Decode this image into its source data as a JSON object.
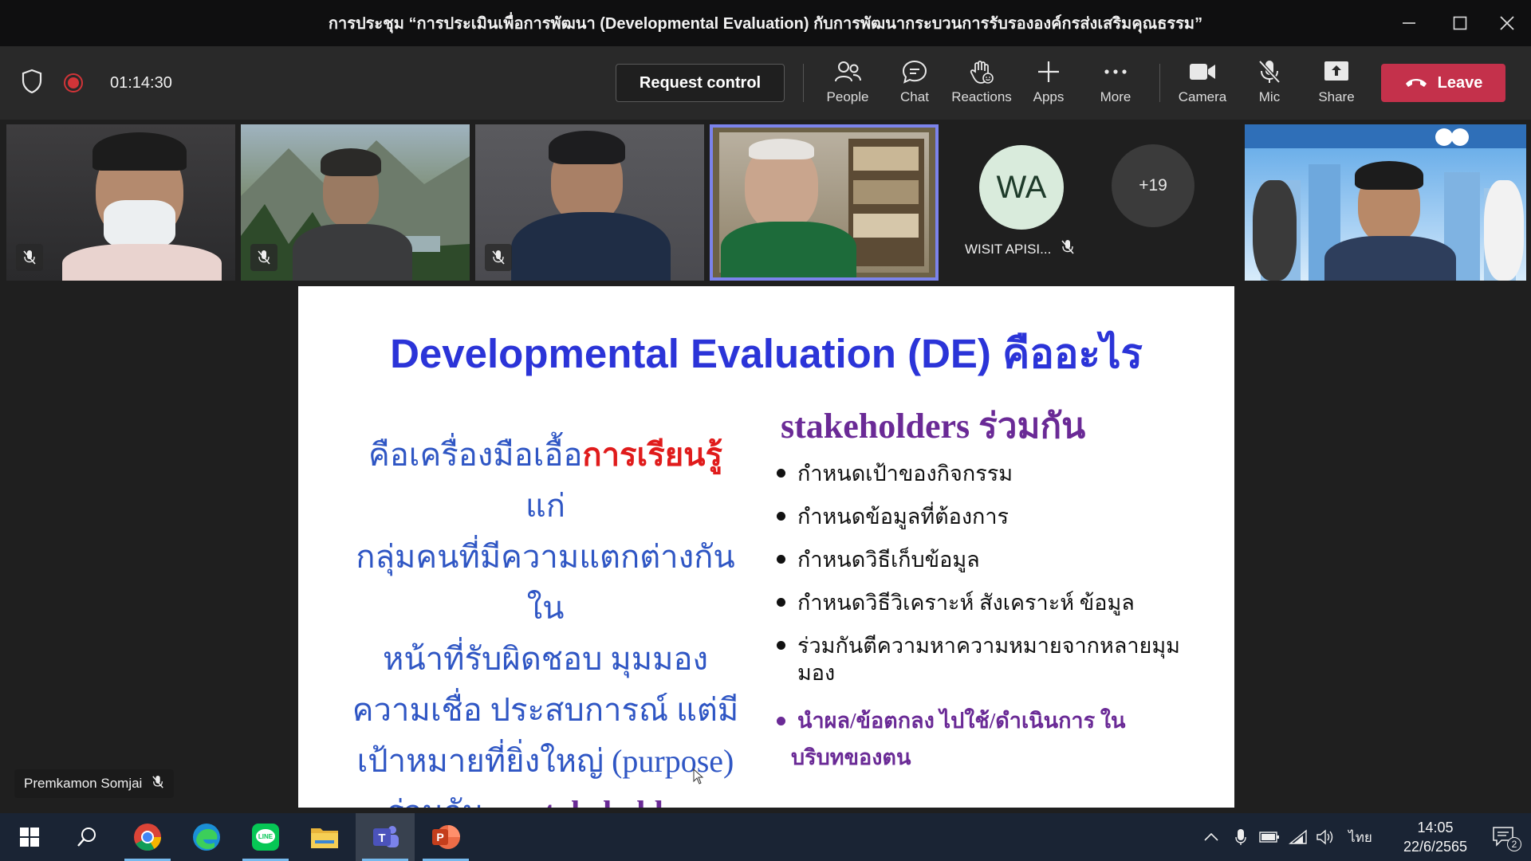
{
  "window": {
    "title": "การประชุม “การประเมินเพื่อการพัฒนา (Developmental Evaluation) กับการพัฒนากระบวนการรับรององค์กรส่งเสริมคุณธรรม”"
  },
  "toolbar": {
    "timer": "01:14:30",
    "request_control": "Request control",
    "people": "People",
    "chat": "Chat",
    "reactions": "Reactions",
    "apps": "Apps",
    "more": "More",
    "camera": "Camera",
    "mic": "Mic",
    "share": "Share",
    "leave": "Leave"
  },
  "participants": {
    "avatar_initials": "WA",
    "avatar_name": "WISIT APISI...",
    "overflow_count": "+19"
  },
  "slide": {
    "title": "Developmental Evaluation (DE) คืออะไร",
    "left_lines": [
      "แก่",
      "กลุ่มคนที่มีความแตกต่างกันใน",
      "หน้าที่รับผิดชอบ  มุมมอง",
      "ความเชื่อ  ประสบการณ์  แต่มี",
      "เป้าหมายที่ยิ่งใหญ่ (purpose)",
      "ร่วมกัน … "
    ],
    "left_prefix": "คือเครื่องมือเอื้อ",
    "left_highlight": "การเรียนรู้",
    "left_stakeholders": "stakeholders",
    "right_title": "stakeholders ร่วมกัน",
    "bullets": [
      "กำหนดเป้าของกิจกรรม",
      "กำหนดข้อมูลที่ต้องการ",
      "กำหนดวิธีเก็บข้อมูล",
      "กำหนดวิธีวิเคราะห์ สังเคราะห์ ข้อมูล",
      "ร่วมกันตีความหาความหมายจากหลายมุมมอง"
    ],
    "last_bullet_line1": "นำผล/ข้อตกลง ไปใช้/ดำเนินการ ใน",
    "last_bullet_line2": "บริบทของตน"
  },
  "presenter": {
    "name": "Premkamon Somjai"
  },
  "taskbar": {
    "lang": "ไทย",
    "time": "14:05",
    "date": "22/6/2565",
    "notifications": "2"
  },
  "colors": {
    "leave": "#c4314b",
    "slide_title": "#2b34d8",
    "active_speaker_border": "#7b83eb",
    "recording": "#d13438"
  }
}
